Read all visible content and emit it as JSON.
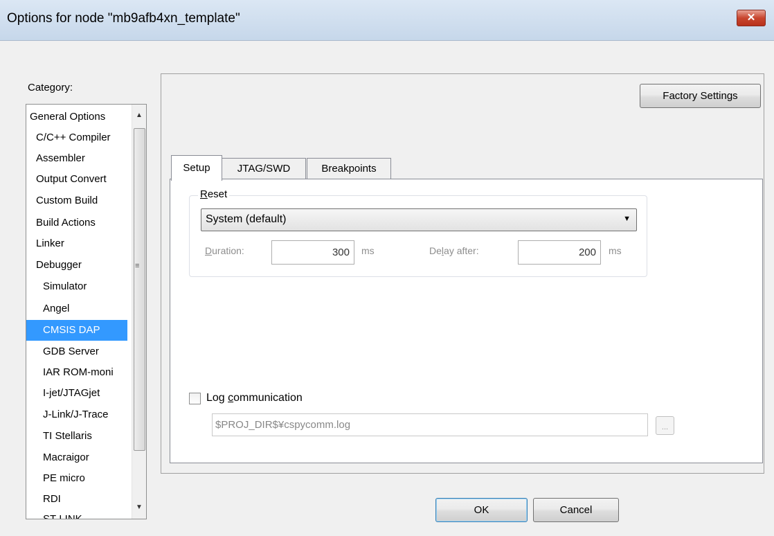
{
  "window": {
    "title": "Options for node \"mb9afb4xn_template\"",
    "close_glyph": "✕"
  },
  "category": {
    "label": "Category:",
    "selected": "CMSIS DAP",
    "items": [
      "General Options",
      "C/C++ Compiler",
      "Assembler",
      "Output Convert",
      "Custom Build",
      "Build Actions",
      "Linker",
      "Debugger",
      "Simulator",
      "Angel",
      "CMSIS DAP",
      "GDB Server",
      "IAR ROM-moni",
      "I-jet/JTAGjet",
      "J-Link/J-Trace",
      "TI Stellaris",
      "Macraigor",
      "PE micro",
      "RDI",
      "ST-LINK"
    ]
  },
  "factory_settings_label": "Factory Settings",
  "tabs": [
    "Setup",
    "JTAG/SWD",
    "Breakpoints"
  ],
  "active_tab": "Setup",
  "reset": {
    "group_label_prefix": "R",
    "group_label_rest": "eset",
    "selected_value": "System (default)",
    "duration": {
      "label_prefix": "D",
      "label_rest": "uration:",
      "value": "300",
      "unit": "ms"
    },
    "delay_after": {
      "label_prefix": "De",
      "label_accel": "l",
      "label_rest": "ay after:",
      "value": "200",
      "unit": "ms"
    }
  },
  "log": {
    "checkbox_prefix": "Log ",
    "checkbox_accel": "c",
    "checkbox_rest": "ommunication",
    "checked": false,
    "path": "$PROJ_DIR$¥cspycomm.log",
    "browse_label": "..."
  },
  "buttons": {
    "ok": "OK",
    "cancel": "Cancel"
  }
}
